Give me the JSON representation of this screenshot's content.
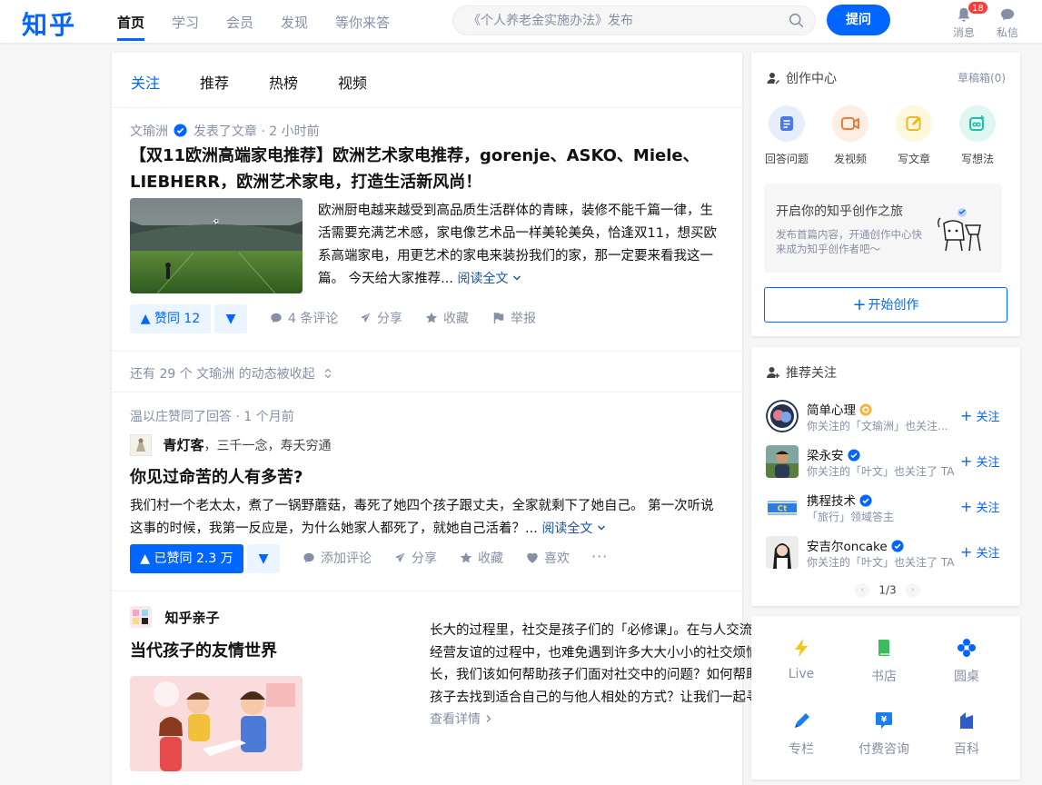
{
  "header": {
    "logo": "知乎",
    "nav": [
      "首页",
      "学习",
      "会员",
      "发现",
      "等你来答"
    ],
    "search_placeholder": "《个人养老金实施办法》发布",
    "ask_label": "提问",
    "notif_label": "消息",
    "notif_count": "18",
    "msg_label": "私信"
  },
  "tabs": [
    "关注",
    "推荐",
    "热榜",
    "视频"
  ],
  "feed": {
    "item1": {
      "author": "文瑜洲",
      "action": "发表了文章 · 2 小时前",
      "title_line1": "【双11欧洲高端家电推荐】欧洲艺术家电推荐，gorenje、ASKO、Miele、",
      "title_line2": "LIEBHERR，欧洲艺术家电，打造生活新风尚！",
      "excerpt": "欧洲厨电越来越受到高品质生活群体的青睐，装修不能千篇一律，生活需要充满艺术感，家电像艺术品一样美轮美奂，恰逢双11，想买欧系高端家电，用更艺术的家电来装扮我们的家，那一定要来看我这一篇。 今天给大家推荐...",
      "read_more": "阅读全文",
      "upvote": "▲ 赞同 12",
      "comments": "4 条评论",
      "share": "分享",
      "collect": "收藏",
      "report": "举报"
    },
    "collapsed": "还有 29 个 文瑜洲 的动态被收起",
    "item2": {
      "meta": "温以庄赞同了回答 · 1 个月前",
      "author_name": "青灯客",
      "author_bio": "，三千一念，寿夭穷通",
      "title": "你见过命苦的人有多苦?",
      "excerpt": "我们村一个老太太，煮了一锅野蘑菇，毒死了她四个孩子跟丈夫，全家就剩下了她自己。 第一次听说这事的时候，我第一反应是，为什么她家人都死了，就她自己活着？...",
      "read_more": "阅读全文",
      "upvote": "▲ 已赞同 2.3 万",
      "comment": "添加评论",
      "share": "分享",
      "collect": "收藏",
      "like": "喜欢",
      "more": "···"
    },
    "item3": {
      "author": "知乎亲子",
      "title": "当代孩子的友情世界",
      "excerpt": "长大的过程里，社交是孩子们的「必修课」。在与人交流、结交朋友、经营友谊的过程中，也难免遇到许多大大小小的社交烦恼。作为家长，我们该如何帮助孩子们面对社交中的问题？如何帮助不同性格的孩子去找到适合自己的与他人相处的方式？让我们一起寻找答案吧！",
      "read_more": "查看详情"
    }
  },
  "sidebar": {
    "creation": {
      "title": "创作中心",
      "draft": "草稿箱(0)",
      "items": [
        "回答问题",
        "发视频",
        "写文章",
        "写想法"
      ],
      "promo_title": "开启你的知乎创作之旅",
      "promo_sub": "发布首篇内容，开通创作中心快来成为知乎创作者吧～",
      "start": "开始创作"
    },
    "recommend": {
      "title": "推荐关注",
      "follow": "关注",
      "users": [
        {
          "name": "简单心理",
          "desc": "你关注的「文瑜洲」也关注..."
        },
        {
          "name": "梁永安",
          "desc": "你关注的「叶文」也关注了 TA"
        },
        {
          "name": "携程技术",
          "desc": "「旅行」领域答主"
        },
        {
          "name": "安吉尔oncake",
          "desc": "你关注的「叶文」也关注了 TA"
        }
      ],
      "page": "1/3"
    },
    "quick": [
      "Live",
      "书店",
      "圆桌",
      "专栏",
      "付费咨询",
      "百科"
    ]
  },
  "colors": {
    "brand": "#0066ff",
    "badge": "#f1403c"
  }
}
